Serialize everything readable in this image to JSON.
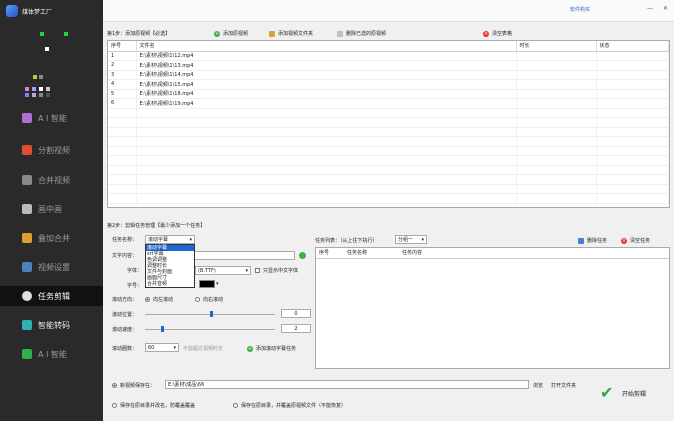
{
  "app": {
    "title": "煤体梦工厂",
    "purchase_link": "软件购买",
    "minimize": "—",
    "close": "✕"
  },
  "sidebar": {
    "items": [
      {
        "label": "A I 智能",
        "active": false
      },
      {
        "label": "分割视频",
        "active": false
      },
      {
        "label": "合并视频",
        "active": false
      },
      {
        "label": "画中画",
        "active": false
      },
      {
        "label": "叠加合并",
        "active": false
      },
      {
        "label": "视频设置",
        "active": false
      },
      {
        "label": "任务剪辑",
        "active": true
      },
      {
        "label": "智能转码",
        "active": false
      },
      {
        "label": "A I 智能",
        "active": false
      }
    ]
  },
  "step1": {
    "label": "第1步：添加原视频【必选】",
    "add_video": "添加原视频",
    "add_folder": "添加视频文件夹",
    "delete_selected": "删除已选的原视频",
    "clear_list": "清空表格",
    "columns": [
      "序号",
      "文件名",
      "时长",
      "状态"
    ],
    "rows": [
      {
        "no": "1",
        "name": "E:\\素材\\视频\\1\\12.mp4"
      },
      {
        "no": "2",
        "name": "E:\\素材\\视频\\1\\13.mp4"
      },
      {
        "no": "3",
        "name": "E:\\素材\\视频\\1\\14.mp4"
      },
      {
        "no": "4",
        "name": "E:\\素材\\视频\\1\\15.mp4"
      },
      {
        "no": "5",
        "name": "E:\\素材\\视频\\1\\18.mp4"
      },
      {
        "no": "6",
        "name": "E:\\素材\\视频\\1\\19.mp4"
      }
    ]
  },
  "step2": {
    "label": "第2步：剪辑任务管理【最少添加一个任务】",
    "task_name_label": "任务名称：",
    "task_name_value": "滚动字幕",
    "task_name_options": [
      "滚动字幕",
      "srt字幕",
      "色调调整",
      "调整时长",
      "文件与封面",
      "画面尺寸",
      "合并音频"
    ],
    "text_content_label": "文字内容：",
    "font_label": "字体：",
    "font_value": "(B.TTF)",
    "show_cn_font": "只显示中文字体",
    "size_label": "字号：",
    "direction_label": "滚动方向：",
    "dir_left": "向左滚动",
    "dir_right": "向右滚动",
    "position_label": "滚动位置：",
    "position_value": "0",
    "speed_label": "滚动速度：",
    "speed_value": "2",
    "count_label": "滚动圈数：",
    "count_value": "60",
    "count_hint": "不能超过视频时长",
    "add_task": "添加滚动字幕任务",
    "task_list_label": "任务列表：（从上往下执行）",
    "task_list_group": "分组一",
    "delete_task": "删除任务",
    "clear_task": "清空任务",
    "task_columns": [
      "序号",
      "任务名称",
      "任务内容"
    ]
  },
  "output": {
    "new_video_label": "新视频保存在：",
    "save_path": "E:\\素材\\成品\\66",
    "browse": "浏览",
    "open_folder": "打开文件夹",
    "option_rename": "保存在原目录并改名，防覆盖覆盖",
    "option_overwrite": "保存在原目录，并覆盖原视频文件（不能恢复）",
    "start": "开始剪辑"
  }
}
